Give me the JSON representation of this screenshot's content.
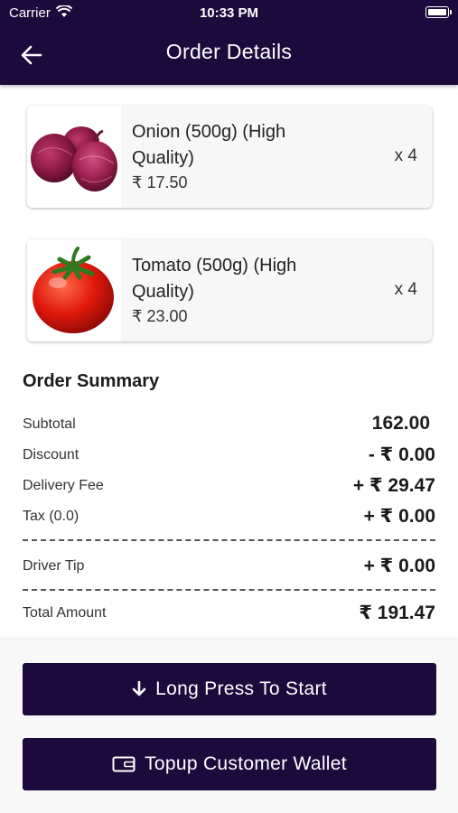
{
  "status_bar": {
    "carrier": "Carrier",
    "time": "10:33 PM"
  },
  "header": {
    "title": "Order Details",
    "back_icon": "arrow-left-icon"
  },
  "items": [
    {
      "name": "Onion (500g) (High Quality)",
      "price": "₹ 17.50",
      "quantity": "x 4",
      "image": "onion-image"
    },
    {
      "name": "Tomato (500g) (High Quality)",
      "price": "₹ 23.00",
      "quantity": "x 4",
      "image": "tomato-image"
    }
  ],
  "summary": {
    "title": "Order Summary",
    "rows": [
      {
        "label": "Subtotal",
        "value": "162.00"
      },
      {
        "label": "Discount",
        "value": "- ₹ 0.00"
      },
      {
        "label": "Delivery Fee",
        "value": "+ ₹ 29.47"
      },
      {
        "label": "Tax (0.0)",
        "value": "+ ₹ 0.00"
      },
      {
        "label": "Driver Tip",
        "value": "+ ₹ 0.00"
      },
      {
        "label": "Total Amount",
        "value": "₹ 191.47"
      }
    ]
  },
  "actions": {
    "start_label": "Long Press To Start",
    "start_icon": "arrow-down-icon",
    "wallet_label": "Topup Customer Wallet",
    "wallet_icon": "wallet-icon"
  },
  "colors": {
    "primary": "#1c0a3d",
    "card_bg": "#f7f7f7"
  }
}
